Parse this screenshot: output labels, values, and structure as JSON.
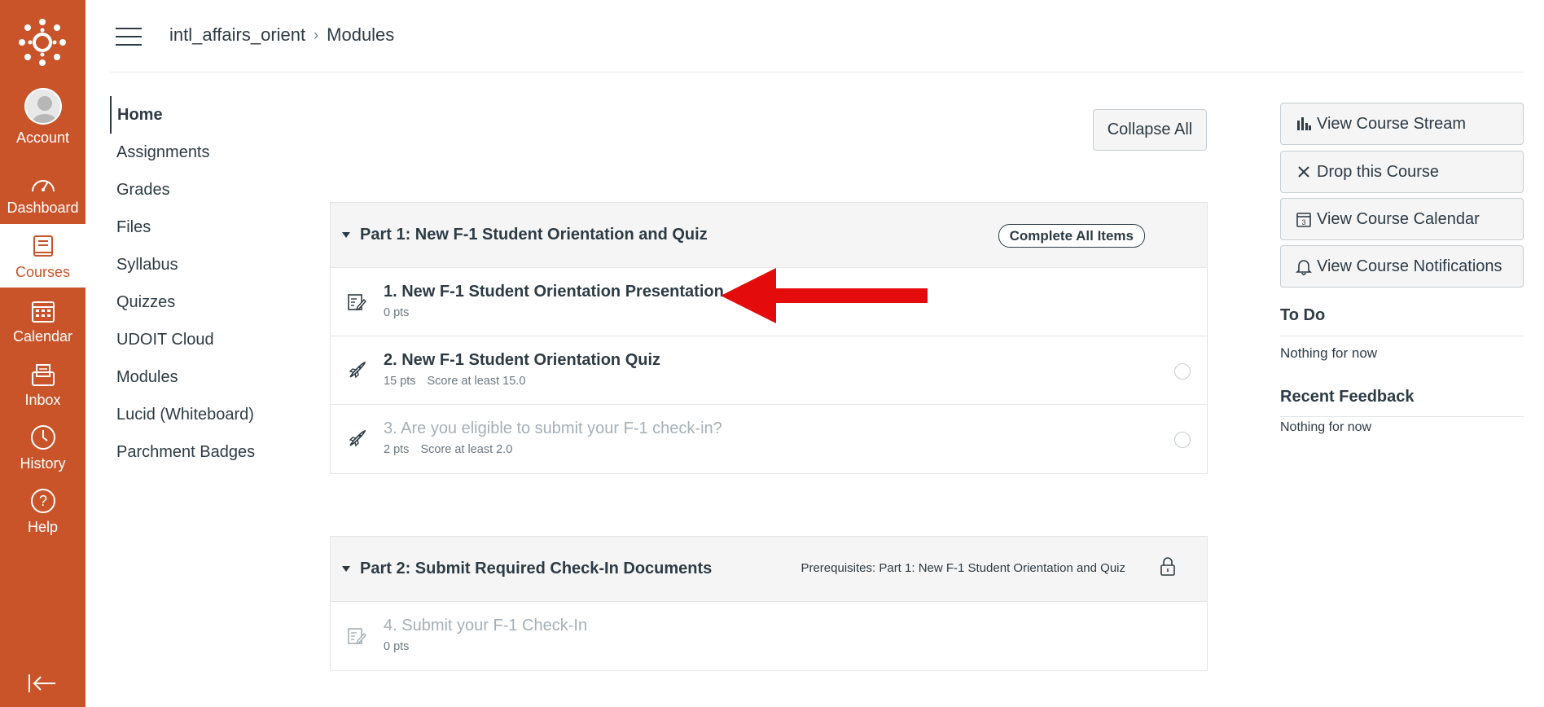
{
  "global_nav": {
    "items": [
      {
        "label": "Account",
        "icon": "avatar-icon"
      },
      {
        "label": "Dashboard",
        "icon": "dashboard-icon"
      },
      {
        "label": "Courses",
        "icon": "courses-icon",
        "active": true
      },
      {
        "label": "Calendar",
        "icon": "calendar-icon"
      },
      {
        "label": "Inbox",
        "icon": "inbox-icon"
      },
      {
        "label": "History",
        "icon": "history-icon"
      },
      {
        "label": "Help",
        "icon": "help-icon"
      }
    ],
    "brand_color": "#c9542a"
  },
  "breadcrumb": {
    "course": "intl_affairs_orient",
    "separator": "›",
    "current": "Modules"
  },
  "course_nav": {
    "items": [
      "Home",
      "Assignments",
      "Grades",
      "Files",
      "Syllabus",
      "Quizzes",
      "UDOIT Cloud",
      "Modules",
      "Lucid (Whiteboard)",
      "Parchment Badges"
    ],
    "active": "Home"
  },
  "toolbar": {
    "collapse_all_label": "Collapse All"
  },
  "modules": [
    {
      "title": "Part 1: New F-1 Student Orientation and Quiz",
      "requirement_label": "Complete All Items",
      "items": [
        {
          "title": "1. New F-1 Student Orientation Presentation",
          "points": "0 pts",
          "requirement": "",
          "icon": "page-icon",
          "locked": false
        },
        {
          "title": "2. New F-1 Student Orientation Quiz",
          "points": "15 pts",
          "requirement": "Score at least 15.0",
          "icon": "quiz-icon",
          "locked": false
        },
        {
          "title": "3. Are you eligible to submit your F-1 check-in?",
          "points": "2 pts",
          "requirement": "Score at least 2.0",
          "icon": "quiz-icon",
          "locked": true
        }
      ]
    },
    {
      "title": "Part 2: Submit Required Check-In Documents",
      "prerequisites": "Prerequisites: Part 1: New F-1 Student Orientation and Quiz",
      "items": [
        {
          "title": "4. Submit your F-1 Check-In",
          "points": "0 pts",
          "icon": "page-icon",
          "locked": true
        }
      ]
    }
  ],
  "sidebar": {
    "buttons": [
      {
        "label": "View Course Stream",
        "icon": "stream-icon"
      },
      {
        "label": "Drop this Course",
        "icon": "close-icon"
      },
      {
        "label": "View Course Calendar",
        "icon": "calendar-icon"
      },
      {
        "label": "View Course Notifications",
        "icon": "bell-icon"
      }
    ],
    "todo_heading": "To Do",
    "todo_text": "Nothing for now",
    "feedback_heading": "Recent Feedback",
    "feedback_text": "Nothing for now"
  },
  "annotation": {
    "arrow_color": "#e30b0b"
  }
}
